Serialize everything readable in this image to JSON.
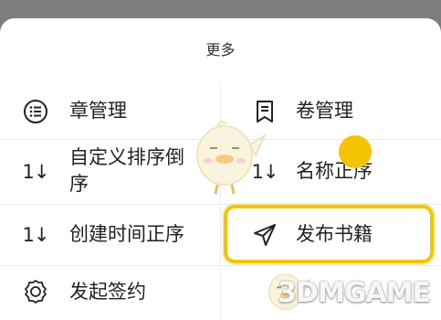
{
  "sheet": {
    "title": "更多"
  },
  "menu": {
    "chapter_manage": {
      "label": "章管理",
      "icon": "list-icon"
    },
    "volume_manage": {
      "label": "卷管理",
      "icon": "book-icon"
    },
    "custom_sort_desc": {
      "label_line1": "自定义排序倒",
      "label_line2": "序",
      "icon": "sort-icon",
      "icon_text": "1↓"
    },
    "name_sort_asc": {
      "label": "名称正序",
      "icon": "sort-icon",
      "icon_text": "1↓"
    },
    "create_time_sort_asc": {
      "label": "创建时间正序",
      "icon": "sort-icon",
      "icon_text": "1↓"
    },
    "publish_book": {
      "label": "发布书籍",
      "icon": "send-icon"
    },
    "start_contract": {
      "label": "发起签约",
      "icon": "award-icon"
    }
  },
  "watermark": {
    "text": "3DMGAME"
  },
  "colors": {
    "highlight": "#f5c400",
    "text": "#222222",
    "backdrop": "#7d7d7d"
  }
}
